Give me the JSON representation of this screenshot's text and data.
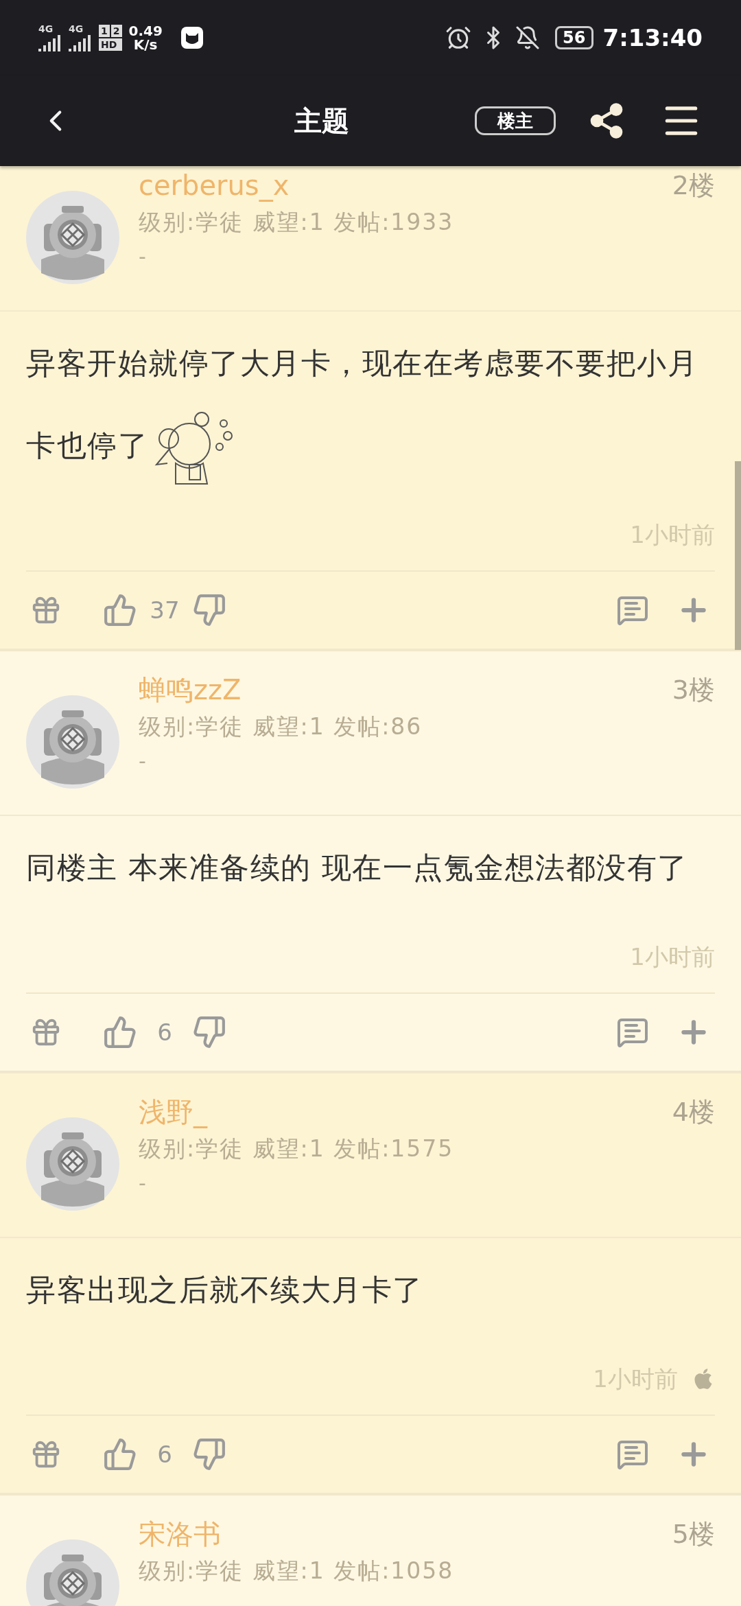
{
  "status_bar": {
    "network_1": "4G",
    "network_2": "4G",
    "sim_1": "1",
    "sim_2": "2",
    "hd": "HD",
    "speed": "0.49",
    "speed_unit": "K/s",
    "battery": "56",
    "time": "7:13:40"
  },
  "header": {
    "title": "主题",
    "author_filter": "楼主"
  },
  "posts": [
    {
      "name": "cerberus_x",
      "floor": "2楼",
      "meta": "级别:学徒 威望:1 发帖:1933",
      "signature": "-",
      "body": [
        {
          "kind": "text",
          "text": "异客开始就停了大月卡，现在在考虑要不要把小月卡也停了"
        },
        {
          "kind": "sticker"
        }
      ],
      "time": "1小时前",
      "likes": "37"
    },
    {
      "name": "蝉鸣zzZ",
      "floor": "3楼",
      "meta": "级别:学徒 威望:1 发帖:86",
      "signature": "-",
      "body": [
        {
          "kind": "text",
          "text": "同楼主 本来准备续的 现在一点氪金想法都没有了"
        }
      ],
      "time": "1小时前",
      "likes": "6"
    },
    {
      "name": "浅野_",
      "floor": "4楼",
      "meta": "级别:学徒 威望:1 发帖:1575",
      "signature": "-",
      "body": [
        {
          "kind": "text",
          "text": "异客出现之后就不续大月卡了"
        }
      ],
      "time": "1小时前",
      "device_icon": true,
      "likes": "6"
    },
    {
      "name": "宋洛书",
      "floor": "5楼",
      "meta": "级别:学徒 威望:1 发帖:1058"
    }
  ]
}
